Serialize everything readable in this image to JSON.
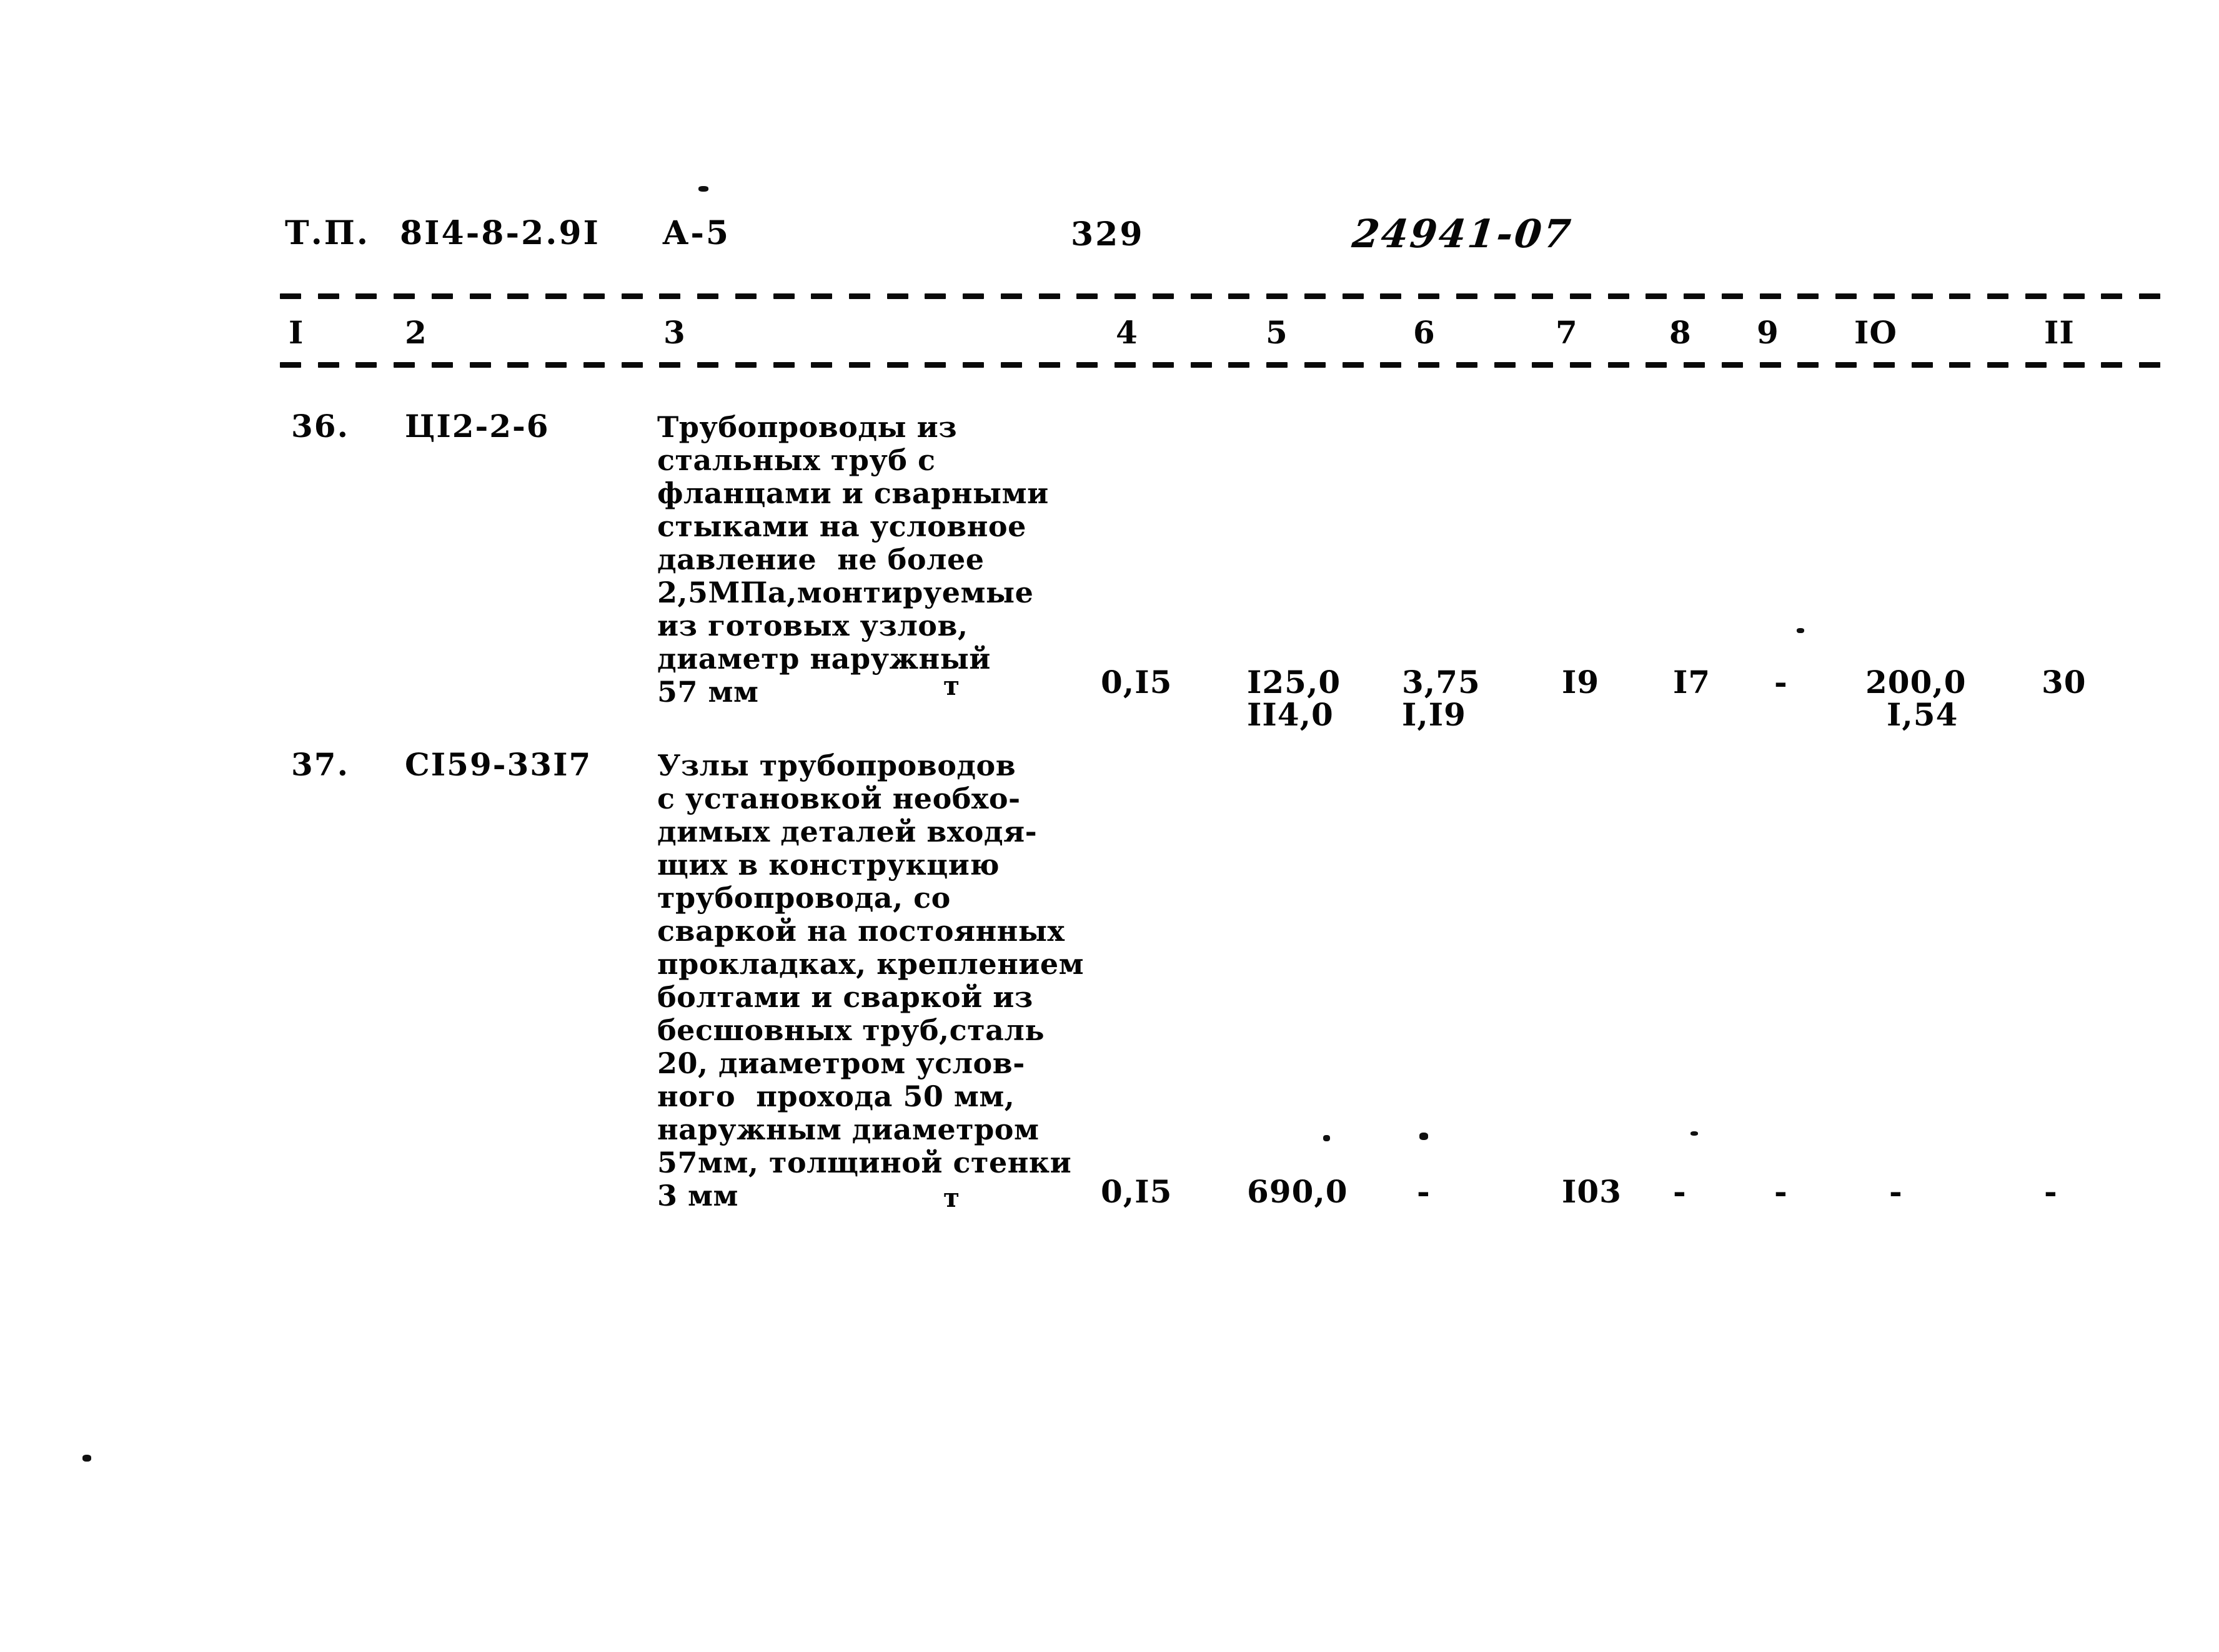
{
  "document": {
    "header": {
      "standard_label": "Т.П.",
      "standard_code": "8I4-8-2.9I",
      "section": "А-5",
      "page_number": "329",
      "stamp_code": "24941-07"
    },
    "column_numbers": [
      "I",
      "2",
      "3",
      "4",
      "5",
      "6",
      "7",
      "8",
      "9",
      "IO",
      "II"
    ],
    "rows": [
      {
        "number": "36.",
        "code": "ЦI2-2-6",
        "description": "Трубопроводы из\nстальных труб с\nфланцами и сварными\nстыками на условное\nдавление  не более\n2,5МПа,монтируемые\nиз готовых узлов,\nдиаметр наружный\n57 мм",
        "unit": "т",
        "col4": "0,I5",
        "col5_top": "I25,0",
        "col5_bottom": "II4,0",
        "col6_top": "3,75",
        "col6_bottom": "I,I9",
        "col7": "I9",
        "col8": "I7",
        "col9": "-",
        "col10_top": "200,0",
        "col10_bottom": "I,54",
        "col11": "30"
      },
      {
        "number": "37.",
        "code": "СI59-33I7",
        "description": "Узлы трубопроводов\nс установкой необхо-\nдимых деталей входя-\nщих в конструкцию\nтрубопровода, со\nсваркой на постоянных\nпрокладках, креплением\nболтами и сваркой из\nбесшовных труб,сталь\n20, диаметром услов-\nного  прохода 50 мм,\nнаружным диаметром\n57мм, толщиной стенки\n3 мм",
        "unit": "т",
        "col4": "0,I5",
        "col5_top": "690,0",
        "col5_bottom": "",
        "col6_top": "-",
        "col6_bottom": "",
        "col7": "I03",
        "col8": "-",
        "col9": "-",
        "col10_top": "-",
        "col10_bottom": "",
        "col11": "-"
      }
    ]
  }
}
